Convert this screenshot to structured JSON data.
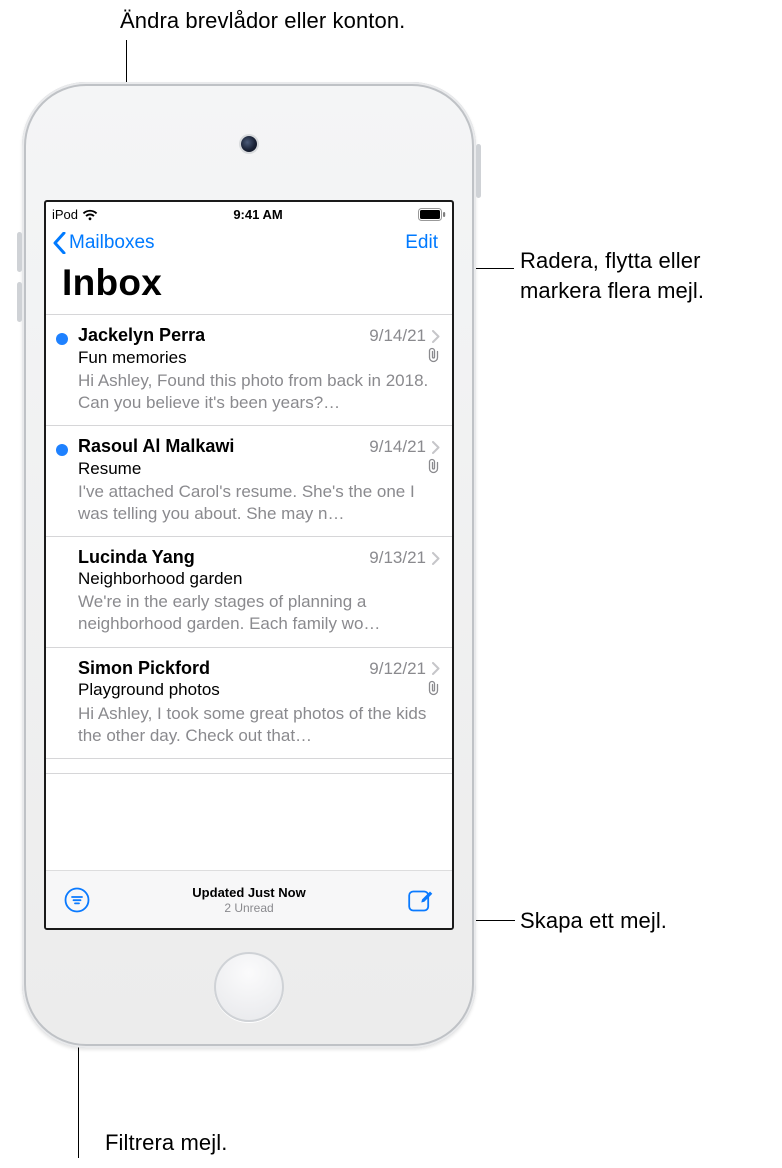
{
  "callouts": {
    "mailboxes": "Ändra brevlådor eller konton.",
    "edit": "Radera, flytta eller\nmarkera flera mejl.",
    "compose": "Skapa ett mejl.",
    "filter": "Filtrera mejl."
  },
  "status": {
    "carrier": "iPod",
    "time": "9:41 AM"
  },
  "nav": {
    "back_label": "Mailboxes",
    "edit_label": "Edit"
  },
  "title": "Inbox",
  "messages": [
    {
      "unread": true,
      "sender": "Jackelyn Perra",
      "date": "9/14/21",
      "has_attachment": true,
      "subject": "Fun memories",
      "preview": "Hi Ashley, Found this photo from back in 2018. Can you believe it's been years?…"
    },
    {
      "unread": true,
      "sender": "Rasoul Al Malkawi",
      "date": "9/14/21",
      "has_attachment": true,
      "subject": "Resume",
      "preview": "I've attached Carol's resume. She's the one I was telling you about. She may n…"
    },
    {
      "unread": false,
      "sender": "Lucinda Yang",
      "date": "9/13/21",
      "has_attachment": false,
      "subject": "Neighborhood garden",
      "preview": "We're in the early stages of planning a neighborhood garden. Each family wo…"
    },
    {
      "unread": false,
      "sender": "Simon Pickford",
      "date": "9/12/21",
      "has_attachment": true,
      "subject": "Playground photos",
      "preview": "Hi Ashley, I took some great photos of the kids the other day. Check out that…"
    }
  ],
  "toolbar": {
    "updated": "Updated Just Now",
    "unread": "2 Unread"
  }
}
